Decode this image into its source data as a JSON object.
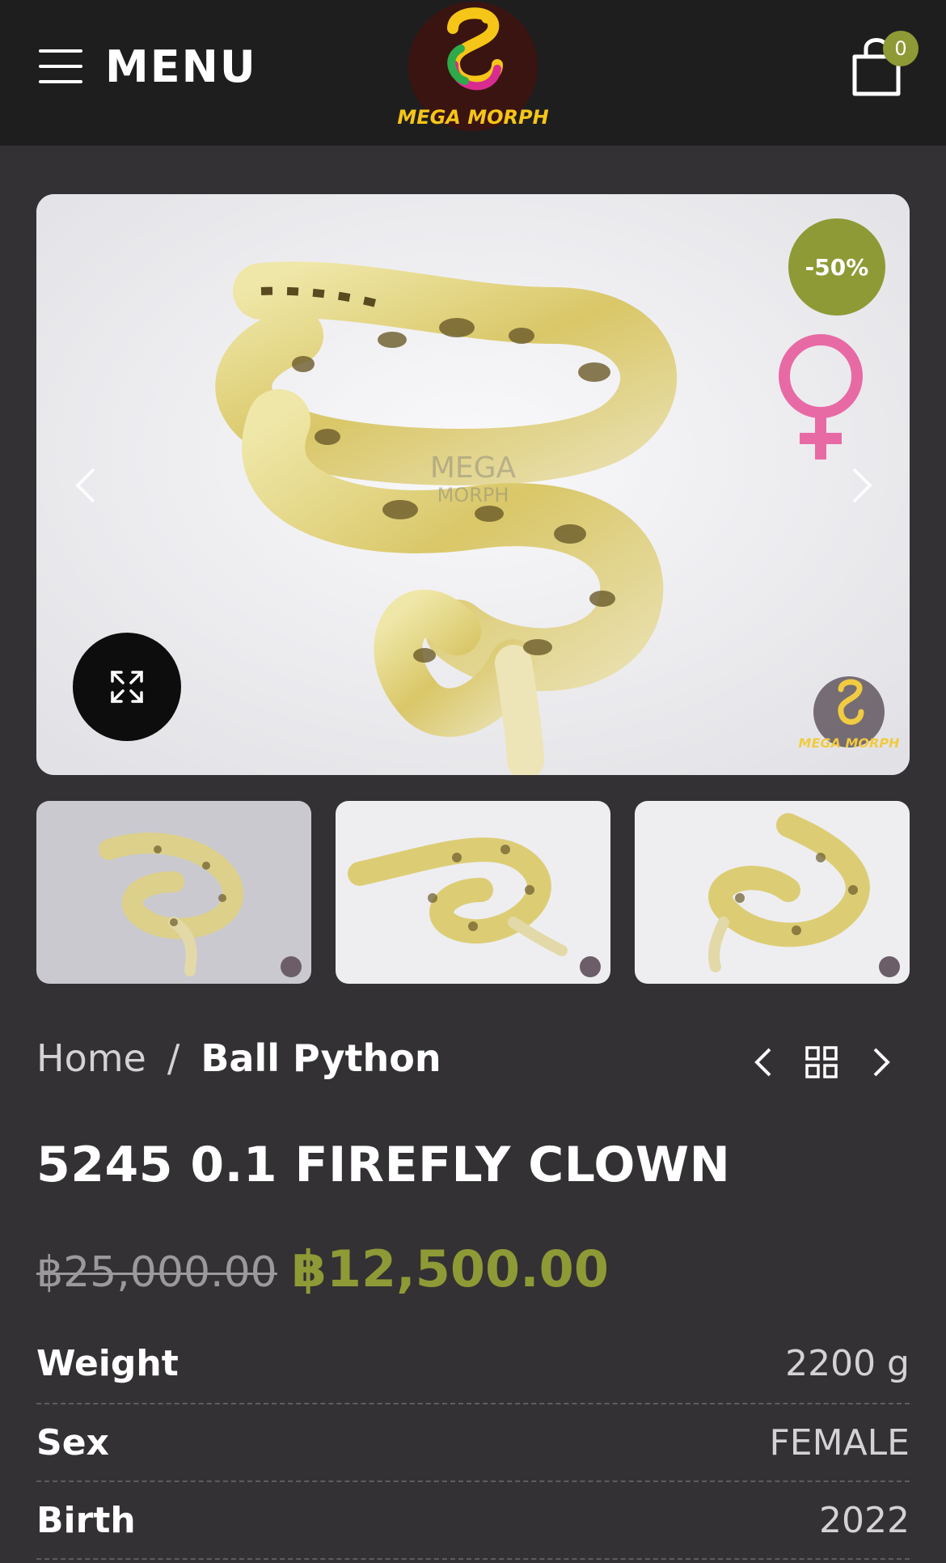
{
  "header": {
    "menu_label": "MENU",
    "logo_text": "MEGA MORPH",
    "cart_count": "0"
  },
  "product": {
    "sale_badge": "-50%",
    "breadcrumb": {
      "home": "Home",
      "separator": "/",
      "category": "Ball Python"
    },
    "title": "5245 0.1 FIREFLY CLOWN",
    "old_price": "฿25,000.00",
    "new_price": "฿12,500.00",
    "specs": [
      {
        "label": "Weight",
        "value": "2200 g"
      },
      {
        "label": "Sex",
        "value": "FEMALE"
      },
      {
        "label": "Birth",
        "value": "2022"
      }
    ]
  },
  "colors": {
    "accent": "#8e9a35",
    "header_bg": "#1f1e1f",
    "page_bg": "#333134",
    "female_symbol": "#e86aa5"
  },
  "icons": {
    "menu": "hamburger-icon",
    "cart": "shopping-bag-icon",
    "zoom": "expand-icon",
    "prev": "chevron-left-icon",
    "next": "chevron-right-icon",
    "grid": "grid-icon",
    "gender": "female-symbol-icon"
  }
}
